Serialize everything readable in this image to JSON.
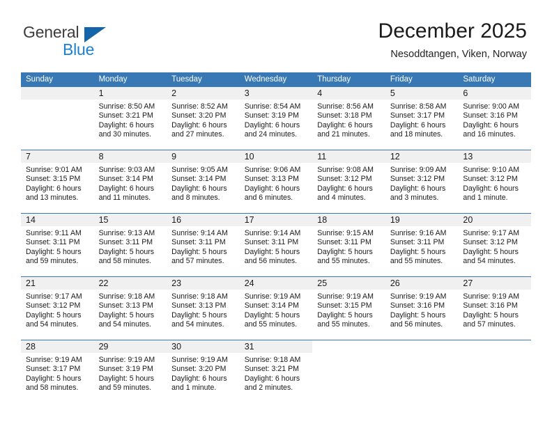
{
  "brand": {
    "name_top": "General",
    "name_bottom": "Blue",
    "accent_color": "#1464aa",
    "blue_text_color": "#1b7fd4"
  },
  "header": {
    "title": "December 2025",
    "subtitle": "Nesoddtangen, Viken, Norway"
  },
  "theme": {
    "header_row_bg": "#3878b4",
    "daynum_band_bg": "#f0f0f0",
    "week_divider": "#3878b4"
  },
  "weekday_headers": [
    "Sunday",
    "Monday",
    "Tuesday",
    "Wednesday",
    "Thursday",
    "Friday",
    "Saturday"
  ],
  "weeks": [
    [
      {
        "day": "",
        "lines": [],
        "empty": true
      },
      {
        "day": "1",
        "lines": [
          "Sunrise: 8:50 AM",
          "Sunset: 3:21 PM",
          "Daylight: 6 hours",
          "and 30 minutes."
        ]
      },
      {
        "day": "2",
        "lines": [
          "Sunrise: 8:52 AM",
          "Sunset: 3:20 PM",
          "Daylight: 6 hours",
          "and 27 minutes."
        ]
      },
      {
        "day": "3",
        "lines": [
          "Sunrise: 8:54 AM",
          "Sunset: 3:19 PM",
          "Daylight: 6 hours",
          "and 24 minutes."
        ]
      },
      {
        "day": "4",
        "lines": [
          "Sunrise: 8:56 AM",
          "Sunset: 3:18 PM",
          "Daylight: 6 hours",
          "and 21 minutes."
        ]
      },
      {
        "day": "5",
        "lines": [
          "Sunrise: 8:58 AM",
          "Sunset: 3:17 PM",
          "Daylight: 6 hours",
          "and 18 minutes."
        ]
      },
      {
        "day": "6",
        "lines": [
          "Sunrise: 9:00 AM",
          "Sunset: 3:16 PM",
          "Daylight: 6 hours",
          "and 16 minutes."
        ]
      }
    ],
    [
      {
        "day": "7",
        "lines": [
          "Sunrise: 9:01 AM",
          "Sunset: 3:15 PM",
          "Daylight: 6 hours",
          "and 13 minutes."
        ]
      },
      {
        "day": "8",
        "lines": [
          "Sunrise: 9:03 AM",
          "Sunset: 3:14 PM",
          "Daylight: 6 hours",
          "and 11 minutes."
        ]
      },
      {
        "day": "9",
        "lines": [
          "Sunrise: 9:05 AM",
          "Sunset: 3:14 PM",
          "Daylight: 6 hours",
          "and 8 minutes."
        ]
      },
      {
        "day": "10",
        "lines": [
          "Sunrise: 9:06 AM",
          "Sunset: 3:13 PM",
          "Daylight: 6 hours",
          "and 6 minutes."
        ]
      },
      {
        "day": "11",
        "lines": [
          "Sunrise: 9:08 AM",
          "Sunset: 3:12 PM",
          "Daylight: 6 hours",
          "and 4 minutes."
        ]
      },
      {
        "day": "12",
        "lines": [
          "Sunrise: 9:09 AM",
          "Sunset: 3:12 PM",
          "Daylight: 6 hours",
          "and 3 minutes."
        ]
      },
      {
        "day": "13",
        "lines": [
          "Sunrise: 9:10 AM",
          "Sunset: 3:12 PM",
          "Daylight: 6 hours",
          "and 1 minute."
        ]
      }
    ],
    [
      {
        "day": "14",
        "lines": [
          "Sunrise: 9:11 AM",
          "Sunset: 3:11 PM",
          "Daylight: 5 hours",
          "and 59 minutes."
        ]
      },
      {
        "day": "15",
        "lines": [
          "Sunrise: 9:13 AM",
          "Sunset: 3:11 PM",
          "Daylight: 5 hours",
          "and 58 minutes."
        ]
      },
      {
        "day": "16",
        "lines": [
          "Sunrise: 9:14 AM",
          "Sunset: 3:11 PM",
          "Daylight: 5 hours",
          "and 57 minutes."
        ]
      },
      {
        "day": "17",
        "lines": [
          "Sunrise: 9:14 AM",
          "Sunset: 3:11 PM",
          "Daylight: 5 hours",
          "and 56 minutes."
        ]
      },
      {
        "day": "18",
        "lines": [
          "Sunrise: 9:15 AM",
          "Sunset: 3:11 PM",
          "Daylight: 5 hours",
          "and 55 minutes."
        ]
      },
      {
        "day": "19",
        "lines": [
          "Sunrise: 9:16 AM",
          "Sunset: 3:11 PM",
          "Daylight: 5 hours",
          "and 55 minutes."
        ]
      },
      {
        "day": "20",
        "lines": [
          "Sunrise: 9:17 AM",
          "Sunset: 3:12 PM",
          "Daylight: 5 hours",
          "and 54 minutes."
        ]
      }
    ],
    [
      {
        "day": "21",
        "lines": [
          "Sunrise: 9:17 AM",
          "Sunset: 3:12 PM",
          "Daylight: 5 hours",
          "and 54 minutes."
        ]
      },
      {
        "day": "22",
        "lines": [
          "Sunrise: 9:18 AM",
          "Sunset: 3:13 PM",
          "Daylight: 5 hours",
          "and 54 minutes."
        ]
      },
      {
        "day": "23",
        "lines": [
          "Sunrise: 9:18 AM",
          "Sunset: 3:13 PM",
          "Daylight: 5 hours",
          "and 54 minutes."
        ]
      },
      {
        "day": "24",
        "lines": [
          "Sunrise: 9:19 AM",
          "Sunset: 3:14 PM",
          "Daylight: 5 hours",
          "and 55 minutes."
        ]
      },
      {
        "day": "25",
        "lines": [
          "Sunrise: 9:19 AM",
          "Sunset: 3:15 PM",
          "Daylight: 5 hours",
          "and 55 minutes."
        ]
      },
      {
        "day": "26",
        "lines": [
          "Sunrise: 9:19 AM",
          "Sunset: 3:16 PM",
          "Daylight: 5 hours",
          "and 56 minutes."
        ]
      },
      {
        "day": "27",
        "lines": [
          "Sunrise: 9:19 AM",
          "Sunset: 3:16 PM",
          "Daylight: 5 hours",
          "and 57 minutes."
        ]
      }
    ],
    [
      {
        "day": "28",
        "lines": [
          "Sunrise: 9:19 AM",
          "Sunset: 3:17 PM",
          "Daylight: 5 hours",
          "and 58 minutes."
        ]
      },
      {
        "day": "29",
        "lines": [
          "Sunrise: 9:19 AM",
          "Sunset: 3:19 PM",
          "Daylight: 5 hours",
          "and 59 minutes."
        ]
      },
      {
        "day": "30",
        "lines": [
          "Sunrise: 9:19 AM",
          "Sunset: 3:20 PM",
          "Daylight: 6 hours",
          "and 1 minute."
        ]
      },
      {
        "day": "31",
        "lines": [
          "Sunrise: 9:18 AM",
          "Sunset: 3:21 PM",
          "Daylight: 6 hours",
          "and 2 minutes."
        ]
      },
      {
        "day": "",
        "lines": [],
        "blank": true
      },
      {
        "day": "",
        "lines": [],
        "blank": true
      },
      {
        "day": "",
        "lines": [],
        "blank": true
      }
    ]
  ]
}
